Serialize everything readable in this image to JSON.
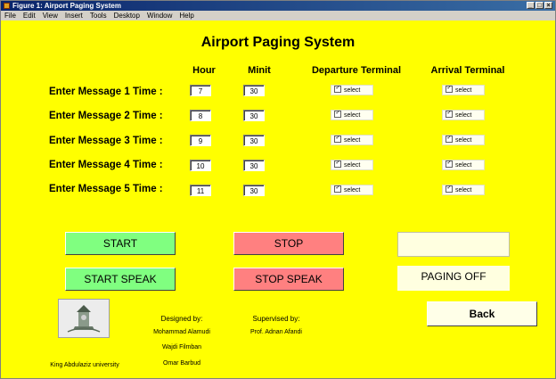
{
  "window": {
    "title": "Figure 1: Airport Paging System",
    "controls": [
      "_",
      "□",
      "×"
    ]
  },
  "menu": [
    "File",
    "Edit",
    "View",
    "Insert",
    "Tools",
    "Desktop",
    "Window",
    "Help"
  ],
  "heading": "Airport Paging System",
  "columns": {
    "hour": "Hour",
    "minit": "Minit",
    "departure": "Departure Terminal",
    "arrival": "Arrival Terminal"
  },
  "rows": [
    {
      "label": "Enter Message 1 Time :",
      "hour": "7",
      "minit": "30",
      "departure": "select",
      "arrival": "select"
    },
    {
      "label": "Enter Message 2 Time :",
      "hour": "8",
      "minit": "30",
      "departure": "select",
      "arrival": "select"
    },
    {
      "label": "Enter Message 3 Time :",
      "hour": "9",
      "minit": "30",
      "departure": "select",
      "arrival": "select"
    },
    {
      "label": "Enter Message 4 Time :",
      "hour": "10",
      "minit": "30",
      "departure": "select",
      "arrival": "select"
    },
    {
      "label": "Enter Message 5 Time :",
      "hour": "11",
      "minit": "30",
      "departure": "select",
      "arrival": "select"
    }
  ],
  "checkbox_checked": true,
  "buttons": {
    "start": "START",
    "stop": "STOP",
    "start_speak": "START SPEAK",
    "stop_speak": "STOP SPEAK",
    "back": "Back"
  },
  "status_top": "",
  "paging_status": "PAGING OFF",
  "credits": {
    "university": "King Abdulaziz university",
    "designed_by_label": "Designed by:",
    "designers": [
      "Mohammad Alamudi",
      "Wajdi Filmban",
      "Omar Barbud"
    ],
    "supervised_by_label": "Supervised by:",
    "supervisor": "Prof. Adnan Afandi"
  },
  "colors": {
    "background": "#ffff00",
    "start_green": "#80ff80",
    "stop_red": "#ff8080",
    "title_bar": "#0a246a"
  }
}
